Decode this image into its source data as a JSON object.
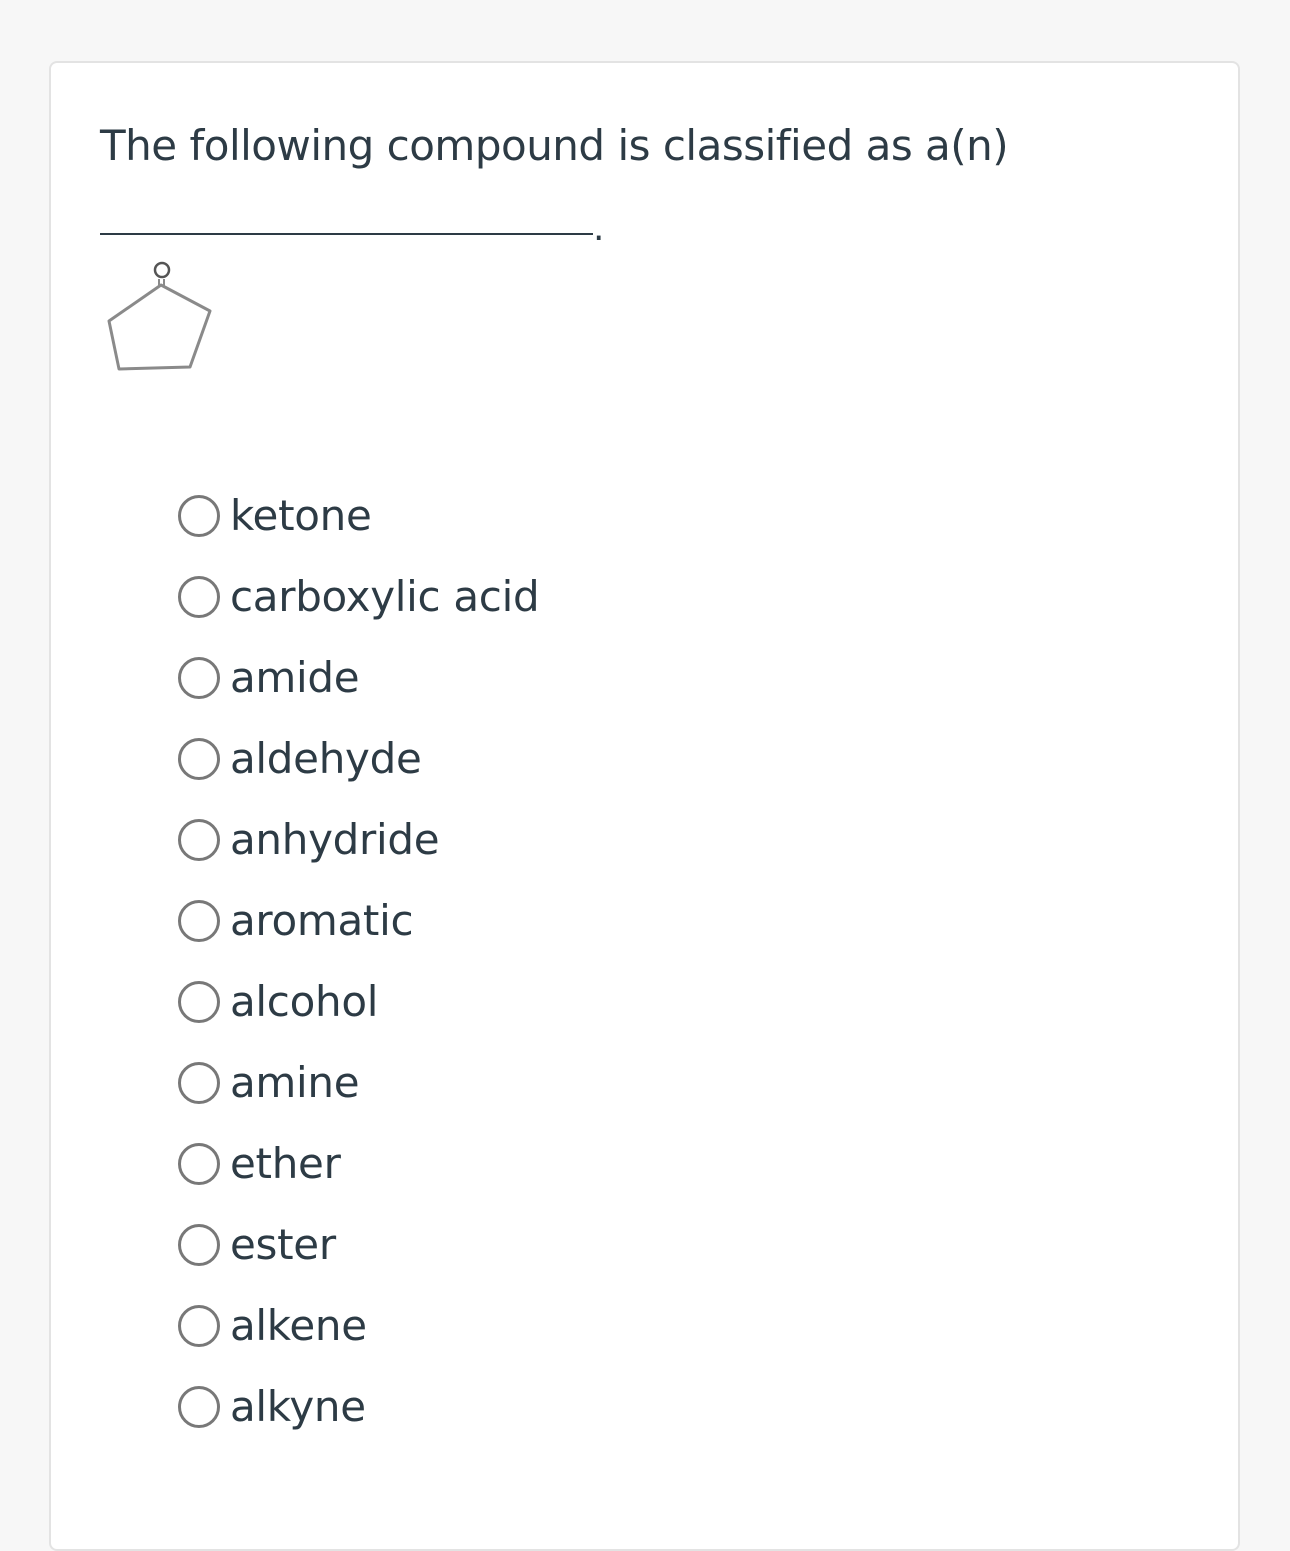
{
  "question": {
    "text": "The following compound is classified as a(n)",
    "blank_suffix": "."
  },
  "molecule_icon": "cyclopentanone-structure-icon",
  "options": [
    {
      "label": "ketone",
      "selected": false
    },
    {
      "label": "carboxylic acid",
      "selected": false
    },
    {
      "label": "amide",
      "selected": false
    },
    {
      "label": "aldehyde",
      "selected": false
    },
    {
      "label": "anhydride",
      "selected": false
    },
    {
      "label": "aromatic",
      "selected": false
    },
    {
      "label": "alcohol",
      "selected": false
    },
    {
      "label": "amine",
      "selected": false
    },
    {
      "label": "ether",
      "selected": false
    },
    {
      "label": "ester",
      "selected": false
    },
    {
      "label": "alkene",
      "selected": false
    },
    {
      "label": "alkyne",
      "selected": false
    }
  ],
  "colors": {
    "text": "#2d3b45",
    "radio_border": "#787878",
    "card_border": "#e3e3e3",
    "page_background": "#f7f7f7"
  }
}
